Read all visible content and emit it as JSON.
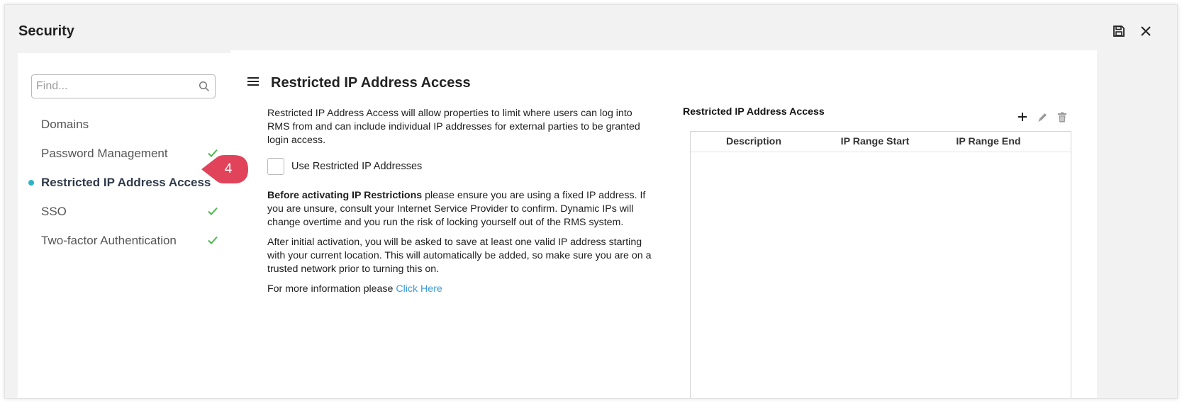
{
  "window": {
    "title": "Security",
    "save_icon": "save-icon",
    "close_icon": "close-icon"
  },
  "sidebar": {
    "search_placeholder": "Find...",
    "items": [
      {
        "label": "Domains",
        "checked": false,
        "active": false
      },
      {
        "label": "Password Management",
        "checked": true,
        "active": false
      },
      {
        "label": "Restricted IP Address Access",
        "checked": false,
        "active": true
      },
      {
        "label": "SSO",
        "checked": true,
        "active": false
      },
      {
        "label": "Two-factor Authentication",
        "checked": true,
        "active": false
      }
    ]
  },
  "callout": {
    "number": "4",
    "color": "#e0435a"
  },
  "main": {
    "title": "Restricted IP Address Access",
    "description": "Restricted IP Address Access will allow properties to limit where users can log into RMS from and can include individual IP addresses for external parties to be granted login access.",
    "checkbox_label": "Use Restricted IP Addresses",
    "warning_bold": "Before activating IP Restrictions",
    "warning_text": " please ensure you are using a fixed IP address. If you are unsure, consult your Internet Service Provider to confirm. Dynamic IPs will change overtime and you run the risk of locking yourself out of the RMS system.",
    "activation_text": "After initial activation, you will be asked to save at least one valid IP address starting with your current location. This will automatically be added, so make sure you are on a trusted network prior to turning this on.",
    "more_info_text": "For more information please ",
    "more_info_link": "Click Here"
  },
  "table": {
    "title": "Restricted IP Address Access",
    "columns": [
      "Description",
      "IP Range Start",
      "IP Range End"
    ],
    "rows": []
  },
  "colors": {
    "accent_dot": "#2bb3c8",
    "check": "#4cb84c",
    "link": "#3b9bd8"
  }
}
